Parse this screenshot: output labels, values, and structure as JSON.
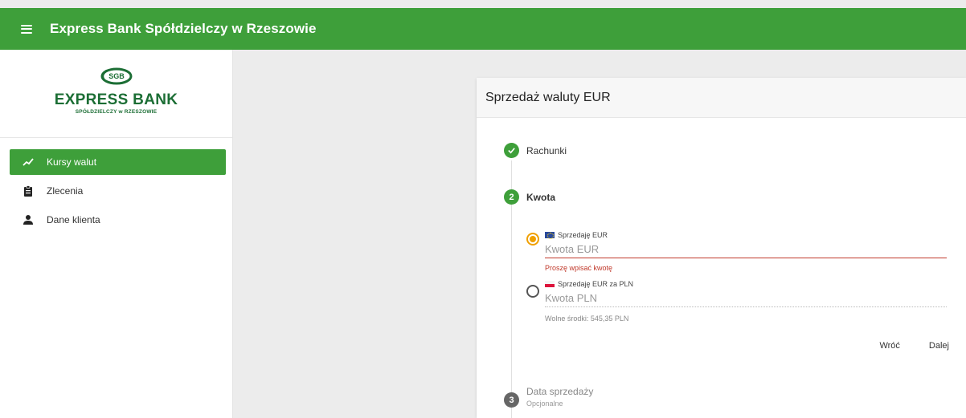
{
  "header": {
    "title": "Express Bank Spółdzielczy w Rzeszowie"
  },
  "logo": {
    "mark": "SGB",
    "main": "EXPRESS BANK",
    "sub": "SPÓŁDZIELCZY w RZESZOWIE"
  },
  "sidebar": {
    "items": [
      {
        "label": "Kursy walut",
        "icon": "trending-up-icon",
        "active": true
      },
      {
        "label": "Zlecenia",
        "icon": "clipboard-icon",
        "active": false
      },
      {
        "label": "Dane klienta",
        "icon": "person-icon",
        "active": false
      }
    ]
  },
  "card": {
    "title": "Sprzedaż waluty EUR",
    "steps": [
      {
        "label": "Rachunki",
        "state": "done"
      },
      {
        "number": "2",
        "label": "Kwota",
        "state": "current"
      },
      {
        "number": "3",
        "label": "Data sprzedaży",
        "sublabel": "Opcjonalne",
        "state": "pending"
      }
    ],
    "options": [
      {
        "label": "Sprzedaję EUR",
        "flag": "eu-flag-icon",
        "placeholder": "Kwota EUR",
        "selected": true,
        "error": "Proszę wpisać kwotę"
      },
      {
        "label": "Sprzedaję EUR za PLN",
        "flag": "pl-flag-icon",
        "placeholder": "Kwota PLN",
        "selected": false,
        "hint": "Wolne środki: 545,35 PLN"
      }
    ],
    "actions": {
      "back_label": "Wróć",
      "next_label": "Dalej"
    }
  },
  "colors": {
    "brand_green": "#3e9f3a",
    "logo_green": "#1c6e35",
    "radio_selected": "#f0a000",
    "error": "#c0392b"
  }
}
